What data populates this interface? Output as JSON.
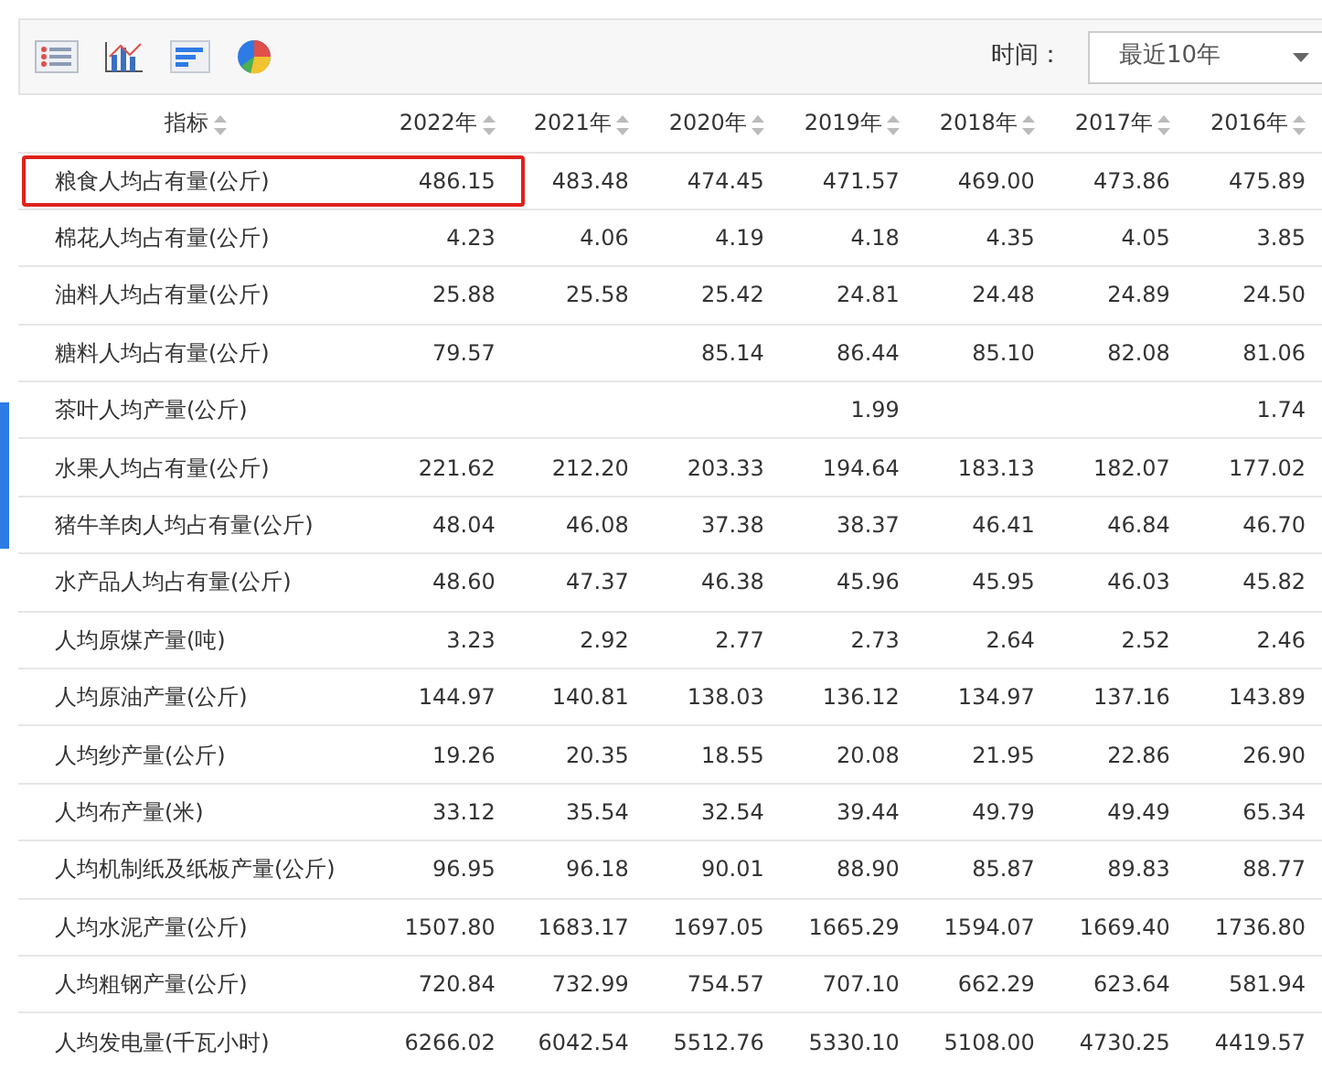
{
  "toolbar": {
    "time_label": "时间：",
    "time_select": "最近10年"
  },
  "table": {
    "columns": [
      "指标",
      "2022年",
      "2021年",
      "2020年",
      "2019年",
      "2018年",
      "2017年",
      "2016年"
    ],
    "rows": [
      {
        "cells": [
          "粮食人均占有量(公斤)",
          "486.15",
          "483.48",
          "474.45",
          "471.57",
          "469.00",
          "473.86",
          "475.89"
        ],
        "highlighted": true
      },
      {
        "cells": [
          "棉花人均占有量(公斤)",
          "4.23",
          "4.06",
          "4.19",
          "4.18",
          "4.35",
          "4.05",
          "3.85"
        ],
        "highlighted": false
      },
      {
        "cells": [
          "油料人均占有量(公斤)",
          "25.88",
          "25.58",
          "25.42",
          "24.81",
          "24.48",
          "24.89",
          "24.50"
        ],
        "highlighted": false
      },
      {
        "cells": [
          "糖料人均占有量(公斤)",
          "79.57",
          "",
          "85.14",
          "86.44",
          "85.10",
          "82.08",
          "81.06"
        ],
        "highlighted": false
      },
      {
        "cells": [
          "茶叶人均产量(公斤)",
          "",
          "",
          "",
          "1.99",
          "",
          "",
          "1.74"
        ],
        "highlighted": false
      },
      {
        "cells": [
          "水果人均占有量(公斤)",
          "221.62",
          "212.20",
          "203.33",
          "194.64",
          "183.13",
          "182.07",
          "177.02"
        ],
        "highlighted": false
      },
      {
        "cells": [
          "猪牛羊肉人均占有量(公斤)",
          "48.04",
          "46.08",
          "37.38",
          "38.37",
          "46.41",
          "46.84",
          "46.70"
        ],
        "highlighted": false
      },
      {
        "cells": [
          "水产品人均占有量(公斤)",
          "48.60",
          "47.37",
          "46.38",
          "45.96",
          "45.95",
          "46.03",
          "45.82"
        ],
        "highlighted": false
      },
      {
        "cells": [
          "人均原煤产量(吨)",
          "3.23",
          "2.92",
          "2.77",
          "2.73",
          "2.64",
          "2.52",
          "2.46"
        ],
        "highlighted": false
      },
      {
        "cells": [
          "人均原油产量(公斤)",
          "144.97",
          "140.81",
          "138.03",
          "136.12",
          "134.97",
          "137.16",
          "143.89"
        ],
        "highlighted": false
      },
      {
        "cells": [
          "人均纱产量(公斤)",
          "19.26",
          "20.35",
          "18.55",
          "20.08",
          "21.95",
          "22.86",
          "26.90"
        ],
        "highlighted": false
      },
      {
        "cells": [
          "人均布产量(米)",
          "33.12",
          "35.54",
          "32.54",
          "39.44",
          "49.79",
          "49.49",
          "65.34"
        ],
        "highlighted": false
      },
      {
        "cells": [
          "人均机制纸及纸板产量(公斤)",
          "96.95",
          "96.18",
          "90.01",
          "88.90",
          "85.87",
          "89.83",
          "88.77"
        ],
        "highlighted": false
      },
      {
        "cells": [
          "人均水泥产量(公斤)",
          "1507.80",
          "1683.17",
          "1697.05",
          "1665.29",
          "1594.07",
          "1669.40",
          "1736.80"
        ],
        "highlighted": false
      },
      {
        "cells": [
          "人均粗钢产量(公斤)",
          "720.84",
          "732.99",
          "754.57",
          "707.10",
          "662.29",
          "623.64",
          "581.94"
        ],
        "highlighted": false
      },
      {
        "cells": [
          "人均发电量(千瓦小时)",
          "6266.02",
          "6042.54",
          "5512.76",
          "5330.10",
          "5108.00",
          "4730.25",
          "4419.57"
        ],
        "highlighted": false
      }
    ]
  }
}
